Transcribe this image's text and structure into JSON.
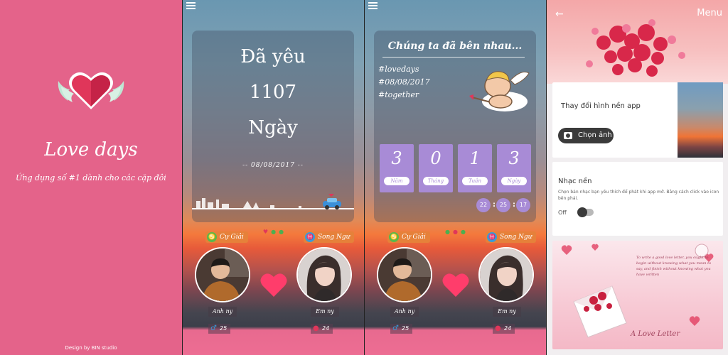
{
  "splash": {
    "title": "Love days",
    "subtitle": "Ứng dụng số #1 dành cho các cặp đôi",
    "credit": "Design by BIN studio"
  },
  "home": {
    "line1": "Đã yêu",
    "days": "1107",
    "unit": "Ngày",
    "date": "-- 08/08/2017 --"
  },
  "couple": {
    "left": {
      "zodiac": "Cự Giải",
      "name": "Anh ny",
      "age": "25"
    },
    "right": {
      "zodiac": "Song Ngư",
      "name": "Em ny",
      "age": "24"
    }
  },
  "together": {
    "heading": "Chúng ta đã bên nhau...",
    "tags": [
      "#lovedays",
      "#08/08/2017",
      "#together"
    ],
    "tiles": [
      {
        "value": "3",
        "label": "Năm"
      },
      {
        "value": "0",
        "label": "Tháng"
      },
      {
        "value": "1",
        "label": "Tuần"
      },
      {
        "value": "3",
        "label": "Ngày"
      }
    ],
    "time": {
      "h": "22",
      "m": "25",
      "s": "17"
    }
  },
  "settings": {
    "menu_title": "Menu",
    "bg_title": "Thay đổi hình nền app",
    "choose_label": "Chọn ảnh",
    "music_title": "Nhạc nền",
    "music_desc": "Chọn bản nhạc bạn yêu thích để phát khi app mở. Bằng cách click vào icon bên phải.",
    "off_label": "Off",
    "letter_text": "To write a good love letter, you ought to begin without knowing what you mean to say, and finish without knowing what you have written",
    "letter_title": "A Love Letter"
  },
  "colors": {
    "pink": "#e4638a",
    "purple": "#a88bd6",
    "orange": "#e6813a"
  }
}
